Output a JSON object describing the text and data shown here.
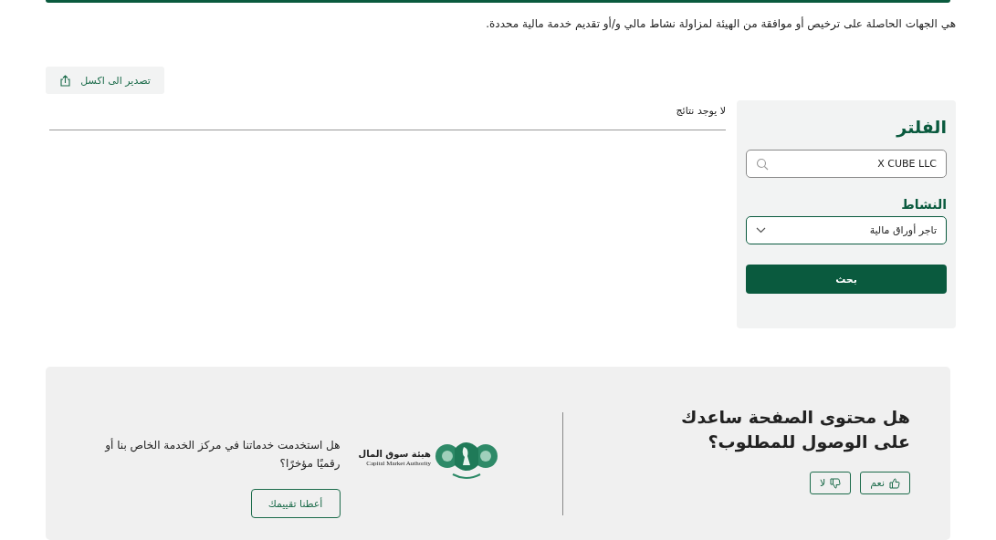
{
  "description": "هي الجهات الحاصلة على ترخيص أو موافقة من الهيئة لمزاولة نشاط مالي و/أو تقديم خدمة مالية محددة.",
  "export_button": {
    "label": "تصدير الى اكسل"
  },
  "filter": {
    "title": "الفلتر",
    "search": {
      "value": "X CUBE LLC"
    },
    "activity_label": "النشاط",
    "activity": {
      "value": "تاجر أوراق مالية"
    },
    "search_button": "بحث"
  },
  "results": {
    "empty_message": "لا يوجد نتائج"
  },
  "feedback": {
    "question": "هل محتوى الصفحة ساعدك على الوصول للمطلوب؟",
    "buttons": [
      {
        "label": "نعم",
        "kind": "yes"
      },
      {
        "label": "لا",
        "kind": "no"
      }
    ],
    "logo": {
      "arabic": "هيئة سوق المال",
      "english": "Capital Market Authority"
    },
    "service_question": "هل استخدمت خدماتنا في مركز الخدمة الخاص بنا أو رقميًا مؤخرًا؟",
    "rate_button": "أعطنا تقييمك"
  }
}
